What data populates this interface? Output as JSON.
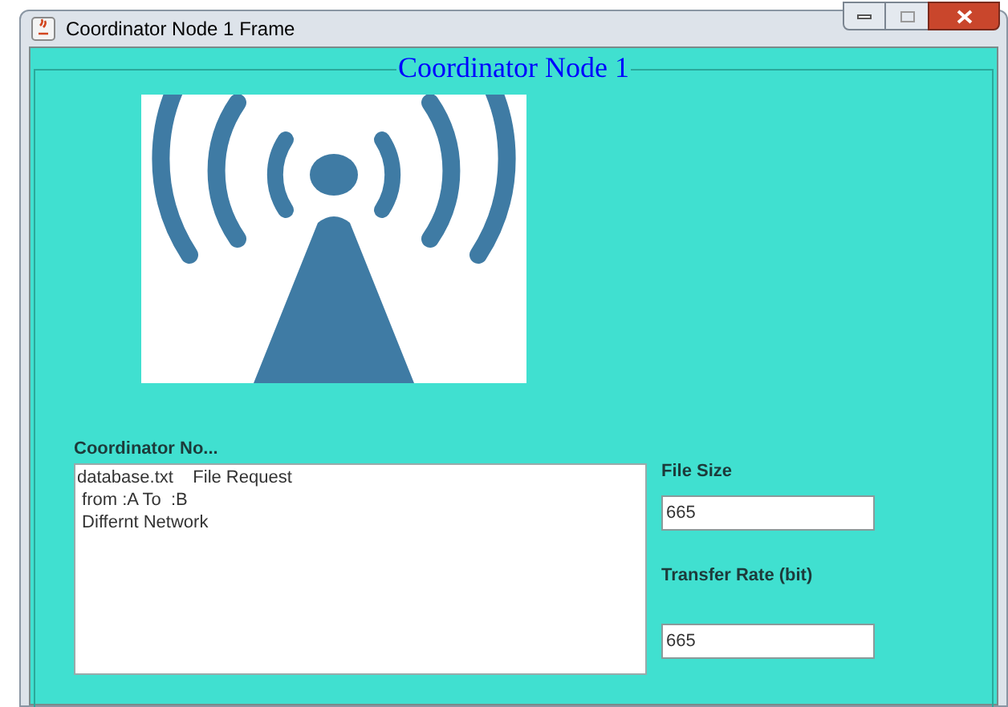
{
  "window": {
    "title": "Coordinator Node 1 Frame"
  },
  "panel": {
    "title": "Coordinator Node 1"
  },
  "log": {
    "label": "Coordinator No...",
    "lines": [
      "database.txt    File Request",
      " from :A To  :B",
      " Differnt Network"
    ]
  },
  "fields": [
    {
      "label": "File Size",
      "value": "665"
    },
    {
      "label": "Transfer Rate (bit)",
      "value": "665"
    }
  ]
}
